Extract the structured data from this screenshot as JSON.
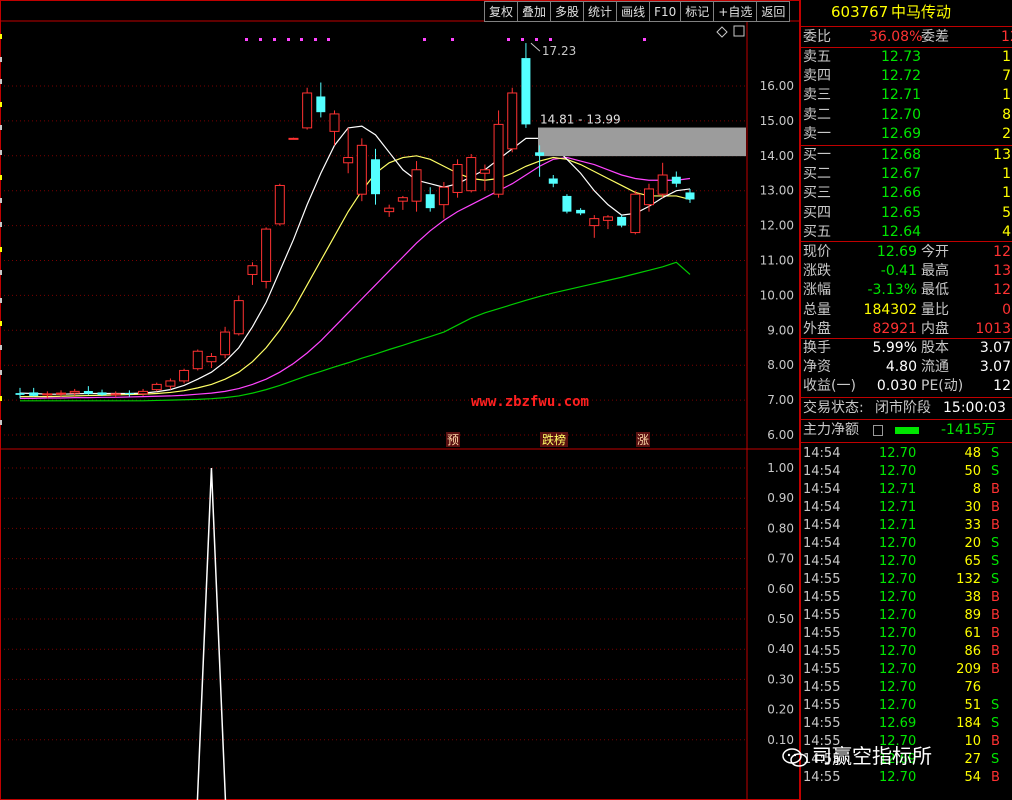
{
  "toolbar": {
    "buttons": [
      "复权",
      "叠加",
      "多股",
      "统计",
      "画线",
      "F10",
      "标记",
      "+自选",
      "返回"
    ]
  },
  "chart_data": [
    {
      "type": "candlestick",
      "panel": "main",
      "ylim": [
        5.8,
        17.8
      ],
      "y_ticks": [
        "16.00",
        "15.00",
        "14.00",
        "13.00",
        "12.00",
        "11.00",
        "10.00",
        "9.00",
        "8.00",
        "7.00",
        "6.00"
      ],
      "grid": true,
      "colors": {
        "up": "#ff3232",
        "down": "#54ffff",
        "ma5": "#ffffff",
        "ma10": "#ffff66",
        "ma20": "#ff44ff",
        "ma60": "#00cc00"
      },
      "candles": [
        {
          "o": 7.2,
          "h": 7.35,
          "l": 7.05,
          "c": 7.15
        },
        {
          "o": 7.22,
          "h": 7.35,
          "l": 7.1,
          "c": 7.12
        },
        {
          "o": 7.15,
          "h": 7.25,
          "l": 7.05,
          "c": 7.18
        },
        {
          "o": 7.18,
          "h": 7.28,
          "l": 7.1,
          "c": 7.2
        },
        {
          "o": 7.2,
          "h": 7.32,
          "l": 7.12,
          "c": 7.25
        },
        {
          "o": 7.26,
          "h": 7.4,
          "l": 7.15,
          "c": 7.18
        },
        {
          "o": 7.22,
          "h": 7.3,
          "l": 7.12,
          "c": 7.15
        },
        {
          "o": 7.15,
          "h": 7.25,
          "l": 7.08,
          "c": 7.18
        },
        {
          "o": 7.2,
          "h": 7.28,
          "l": 7.1,
          "c": 7.17
        },
        {
          "o": 7.18,
          "h": 7.32,
          "l": 7.12,
          "c": 7.25
        },
        {
          "o": 7.3,
          "h": 7.5,
          "l": 7.25,
          "c": 7.45
        },
        {
          "o": 7.4,
          "h": 7.62,
          "l": 7.3,
          "c": 7.55
        },
        {
          "o": 7.55,
          "h": 7.9,
          "l": 7.48,
          "c": 7.85
        },
        {
          "o": 7.9,
          "h": 8.45,
          "l": 7.85,
          "c": 8.4
        },
        {
          "o": 8.1,
          "h": 8.35,
          "l": 7.92,
          "c": 8.25
        },
        {
          "o": 8.3,
          "h": 9.1,
          "l": 8.2,
          "c": 8.95
        },
        {
          "o": 8.9,
          "h": 10.0,
          "l": 8.85,
          "c": 9.85
        },
        {
          "o": 10.6,
          "h": 10.95,
          "l": 10.3,
          "c": 10.85
        },
        {
          "o": 10.4,
          "h": 11.95,
          "l": 10.2,
          "c": 11.9
        },
        {
          "o": 12.05,
          "h": 13.2,
          "l": 12.0,
          "c": 13.15
        },
        {
          "o": 14.5,
          "h": 14.52,
          "l": 14.48,
          "c": 14.5
        },
        {
          "o": 14.8,
          "h": 15.95,
          "l": 14.75,
          "c": 15.8
        },
        {
          "o": 15.7,
          "h": 16.1,
          "l": 15.1,
          "c": 15.25
        },
        {
          "o": 14.7,
          "h": 15.3,
          "l": 14.3,
          "c": 15.2
        },
        {
          "o": 13.8,
          "h": 14.8,
          "l": 13.5,
          "c": 13.95
        },
        {
          "o": 12.9,
          "h": 14.5,
          "l": 12.7,
          "c": 14.3
        },
        {
          "o": 13.9,
          "h": 14.2,
          "l": 12.6,
          "c": 12.9
        },
        {
          "o": 12.4,
          "h": 12.6,
          "l": 12.25,
          "c": 12.5
        },
        {
          "o": 12.7,
          "h": 12.85,
          "l": 12.45,
          "c": 12.8
        },
        {
          "o": 12.7,
          "h": 13.85,
          "l": 12.4,
          "c": 13.6
        },
        {
          "o": 12.9,
          "h": 13.1,
          "l": 12.4,
          "c": 12.5
        },
        {
          "o": 12.6,
          "h": 13.25,
          "l": 12.2,
          "c": 13.1
        },
        {
          "o": 12.95,
          "h": 13.9,
          "l": 12.8,
          "c": 13.75
        },
        {
          "o": 13.0,
          "h": 14.05,
          "l": 12.95,
          "c": 13.95
        },
        {
          "o": 13.5,
          "h": 13.75,
          "l": 13.0,
          "c": 13.6
        },
        {
          "o": 12.9,
          "h": 15.3,
          "l": 12.8,
          "c": 14.9
        },
        {
          "o": 14.2,
          "h": 15.95,
          "l": 14.1,
          "c": 15.8
        },
        {
          "o": 16.8,
          "h": 17.23,
          "l": 14.8,
          "c": 14.9
        },
        {
          "o": 14.1,
          "h": 14.3,
          "l": 13.4,
          "c": 14.0
        },
        {
          "o": 13.35,
          "h": 13.45,
          "l": 13.1,
          "c": 13.2
        },
        {
          "o": 12.85,
          "h": 12.9,
          "l": 12.35,
          "c": 12.4
        },
        {
          "o": 12.45,
          "h": 12.5,
          "l": 12.3,
          "c": 12.35
        },
        {
          "o": 12.0,
          "h": 12.3,
          "l": 11.65,
          "c": 12.2
        },
        {
          "o": 12.15,
          "h": 12.3,
          "l": 11.9,
          "c": 12.25
        },
        {
          "o": 12.25,
          "h": 12.3,
          "l": 11.95,
          "c": 12.0
        },
        {
          "o": 11.8,
          "h": 13.0,
          "l": 11.75,
          "c": 12.9
        },
        {
          "o": 12.6,
          "h": 13.2,
          "l": 12.4,
          "c": 13.05
        },
        {
          "o": 12.9,
          "h": 13.8,
          "l": 12.8,
          "c": 13.45
        },
        {
          "o": 13.4,
          "h": 13.55,
          "l": 13.1,
          "c": 13.2
        },
        {
          "o": 12.95,
          "h": 13.05,
          "l": 12.65,
          "c": 12.75
        }
      ],
      "ma_series": {
        "ma5": [
          7.2,
          7.19,
          7.17,
          7.17,
          7.18,
          7.19,
          7.19,
          7.19,
          7.19,
          7.2,
          7.24,
          7.3,
          7.42,
          7.6,
          7.8,
          8.1,
          8.5,
          9.1,
          9.8,
          10.7,
          11.6,
          12.6,
          13.5,
          14.3,
          14.8,
          14.85,
          14.6,
          14.1,
          13.6,
          13.3,
          13.2,
          13.1,
          13.2,
          13.4,
          13.6,
          13.9,
          14.2,
          14.5,
          14.5,
          14.3,
          13.9,
          13.5,
          13.0,
          12.6,
          12.3,
          12.35,
          12.55,
          12.8,
          13.0,
          13.05
        ],
        "ma10": [
          7.1,
          7.1,
          7.1,
          7.11,
          7.12,
          7.13,
          7.14,
          7.15,
          7.16,
          7.17,
          7.19,
          7.22,
          7.27,
          7.35,
          7.45,
          7.6,
          7.8,
          8.1,
          8.5,
          9.0,
          9.6,
          10.3,
          11.0,
          11.7,
          12.4,
          13.0,
          13.5,
          13.8,
          13.95,
          14.0,
          13.9,
          13.7,
          13.5,
          13.35,
          13.3,
          13.35,
          13.5,
          13.7,
          13.85,
          13.95,
          13.9,
          13.75,
          13.55,
          13.35,
          13.15,
          12.95,
          12.85,
          12.85,
          12.85,
          12.75
        ],
        "ma20": [
          7.05,
          7.05,
          7.06,
          7.06,
          7.07,
          7.07,
          7.08,
          7.08,
          7.09,
          7.1,
          7.11,
          7.12,
          7.14,
          7.17,
          7.2,
          7.25,
          7.33,
          7.45,
          7.6,
          7.8,
          8.05,
          8.35,
          8.7,
          9.1,
          9.5,
          9.9,
          10.3,
          10.7,
          11.1,
          11.5,
          11.85,
          12.15,
          12.4,
          12.6,
          12.8,
          13.0,
          13.2,
          13.45,
          13.7,
          13.9,
          13.95,
          13.85,
          13.75,
          13.6,
          13.45,
          13.35,
          13.3,
          13.3,
          13.3,
          13.35
        ],
        "ma60": [
          6.98,
          6.98,
          6.98,
          6.98,
          6.98,
          6.98,
          6.98,
          6.98,
          6.98,
          6.98,
          6.99,
          7.0,
          7.01,
          7.02,
          7.04,
          7.07,
          7.12,
          7.2,
          7.3,
          7.42,
          7.56,
          7.7,
          7.82,
          7.95,
          8.07,
          8.2,
          8.32,
          8.45,
          8.57,
          8.7,
          8.82,
          8.95,
          9.15,
          9.35,
          9.5,
          9.62,
          9.74,
          9.86,
          9.97,
          10.07,
          10.16,
          10.25,
          10.34,
          10.43,
          10.52,
          10.62,
          10.72,
          10.82,
          10.95,
          10.6
        ]
      },
      "annotations": {
        "high_label": "17.23",
        "range_label": "14.81 - 13.99",
        "markers": [
          "预",
          "跌榜",
          "涨"
        ],
        "watermark": "www.zbzfwu.com"
      }
    },
    {
      "type": "line",
      "panel": "indicator",
      "ylim": [
        0,
        1.05
      ],
      "y_ticks": [
        "1.00",
        "0.90",
        "0.80",
        "0.70",
        "0.60",
        "0.50",
        "0.40",
        "0.30",
        "0.20",
        "0.10"
      ],
      "grid": true,
      "series": [
        {
          "values": [
            0,
            0,
            0,
            0,
            0,
            0,
            0,
            0,
            0,
            0,
            0,
            0,
            0,
            0,
            0,
            0,
            0,
            0,
            0,
            0,
            0,
            0,
            0,
            0,
            0,
            0,
            0,
            0,
            0,
            0,
            0,
            0,
            0,
            0,
            0,
            0,
            0,
            0,
            0,
            0,
            0,
            0,
            0,
            0,
            0,
            0,
            0,
            0,
            0,
            0
          ],
          "spike_index": 14,
          "spike_value": 1.0
        }
      ]
    }
  ],
  "quote": {
    "code": "603767",
    "name": "中马传动",
    "weibi_label": "委比",
    "weibi_value": "36.08%",
    "weicha_label": "委差",
    "weicha_value": "12",
    "asks": [
      {
        "label": "卖五",
        "price": "12.73",
        "vol": "1"
      },
      {
        "label": "卖四",
        "price": "12.72",
        "vol": "7"
      },
      {
        "label": "卖三",
        "price": "12.71",
        "vol": "1"
      },
      {
        "label": "卖二",
        "price": "12.70",
        "vol": "8"
      },
      {
        "label": "卖一",
        "price": "12.69",
        "vol": "2"
      }
    ],
    "bids": [
      {
        "label": "买一",
        "price": "12.68",
        "vol": "13"
      },
      {
        "label": "买二",
        "price": "12.67",
        "vol": "1"
      },
      {
        "label": "买三",
        "price": "12.66",
        "vol": "1"
      },
      {
        "label": "买四",
        "price": "12.65",
        "vol": "5"
      },
      {
        "label": "买五",
        "price": "12.64",
        "vol": "4"
      }
    ],
    "stats": [
      {
        "l1": "现价",
        "v1": "12.69",
        "c1": "green",
        "l2": "今开",
        "v2": "12"
      },
      {
        "l1": "涨跌",
        "v1": "-0.41",
        "c1": "green",
        "l2": "最高",
        "v2": "13"
      },
      {
        "l1": "涨幅",
        "v1": "-3.13%",
        "c1": "green",
        "l2": "最低",
        "v2": "12"
      },
      {
        "l1": "总量",
        "v1": "184302",
        "c1": "yellow",
        "l2": "量比",
        "v2": "0"
      },
      {
        "l1": "外盘",
        "v1": "82921",
        "c1": "red",
        "l2": "内盘",
        "v2": "1013"
      }
    ],
    "stats2": [
      {
        "l1": "换手",
        "v1": "5.99%",
        "l2": "股本",
        "v2": "3.07"
      },
      {
        "l1": "净资",
        "v1": "4.80",
        "l2": "流通",
        "v2": "3.07"
      },
      {
        "l1": "收益(一)",
        "v1": "0.030",
        "l2": "PE(动)",
        "v2": "12"
      }
    ],
    "trade_status_label": "交易状态:",
    "trade_status_value": "闭市阶段",
    "trade_status_time": "15:00:03",
    "main_net_label": "主力净额",
    "main_net_value": "-1415万"
  },
  "trades": [
    {
      "time": "14:54",
      "price": "12.70",
      "vol": "48",
      "bs": "S"
    },
    {
      "time": "14:54",
      "price": "12.70",
      "vol": "50",
      "bs": "S"
    },
    {
      "time": "14:54",
      "price": "12.71",
      "vol": "8",
      "bs": "B"
    },
    {
      "time": "14:54",
      "price": "12.71",
      "vol": "30",
      "bs": "B"
    },
    {
      "time": "14:54",
      "price": "12.71",
      "vol": "33",
      "bs": "B"
    },
    {
      "time": "14:54",
      "price": "12.70",
      "vol": "20",
      "bs": "S"
    },
    {
      "time": "14:54",
      "price": "12.70",
      "vol": "65",
      "bs": "S"
    },
    {
      "time": "14:55",
      "price": "12.70",
      "vol": "132",
      "bs": "S"
    },
    {
      "time": "14:55",
      "price": "12.70",
      "vol": "38",
      "bs": "B"
    },
    {
      "time": "14:55",
      "price": "12.70",
      "vol": "89",
      "bs": "B"
    },
    {
      "time": "14:55",
      "price": "12.70",
      "vol": "61",
      "bs": "B"
    },
    {
      "time": "14:55",
      "price": "12.70",
      "vol": "86",
      "bs": "B"
    },
    {
      "time": "14:55",
      "price": "12.70",
      "vol": "209",
      "bs": "B"
    },
    {
      "time": "14:55",
      "price": "12.70",
      "vol": "76",
      "bs": ""
    },
    {
      "time": "14:55",
      "price": "12.70",
      "vol": "51",
      "bs": "S"
    },
    {
      "time": "14:55",
      "price": "12.69",
      "vol": "184",
      "bs": "S"
    },
    {
      "time": "14:55",
      "price": "12.70",
      "vol": "10",
      "bs": "B"
    },
    {
      "time": "14:55",
      "price": "12.69",
      "vol": "27",
      "bs": "S"
    },
    {
      "time": "14:55",
      "price": "12.70",
      "vol": "54",
      "bs": "B"
    }
  ],
  "watermark_text": "司赢空指标所"
}
